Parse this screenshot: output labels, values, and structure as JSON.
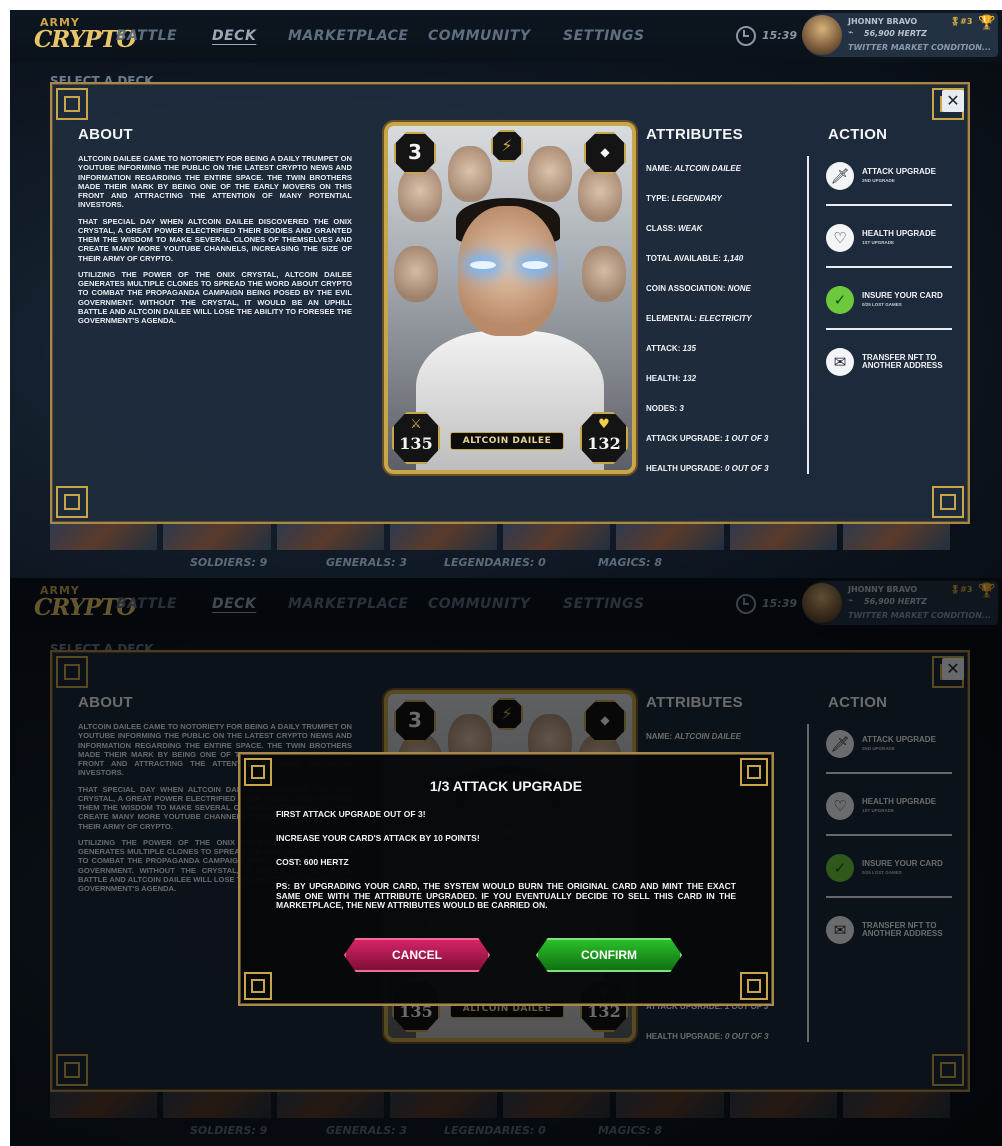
{
  "nav": {
    "logo_top": "ARMY",
    "logo_bottom": "CRYPTO",
    "items": [
      "BATTLE",
      "DECK",
      "MARKETPLACE",
      "COMMUNITY",
      "SETTINGS"
    ],
    "time": "15:39"
  },
  "user": {
    "name": "JHONNY BRAVO",
    "hertz": "56,900 HERTZ",
    "rank": "#3",
    "ticker": "TWITTER MARKET CONDITION..."
  },
  "deck": {
    "select_label": "SELECT A DECK",
    "counts": [
      "SOLDIERS: 9",
      "GENERALS: 3",
      "LEGENDARIES: 0",
      "MAGICS: 8"
    ]
  },
  "about": {
    "title": "ABOUT",
    "paragraphs": [
      "ALTCOIN DAILEE CAME TO NOTORIETY FOR BEING A DAILY TRUMPET ON YOUTUBE INFORMING THE PUBLIC ON THE LATEST CRYPTO NEWS AND INFORMATION REGARDING THE ENTIRE SPACE. THE TWIN BROTHERS MADE THEIR MARK BY BEING ONE OF THE EARLY MOVERS ON THIS FRONT AND ATTRACTING THE ATTENTION OF MANY POTENTIAL INVESTORS.",
      "THAT SPECIAL DAY WHEN ALTCOIN DAILEE DISCOVERED THE ONIX CRYSTAL, A GREAT POWER ELECTRIFIED THEIR BODIES AND GRANTED THEM THE WISDOM TO MAKE SEVERAL CLONES OF THEMSELVES AND CREATE MANY MORE YOUTUBE CHANNELS, INCREASING THE SIZE OF THEIR ARMY OF CRYPTO.",
      "UTILIZING THE POWER OF THE ONIX CRYSTAL, ALTCOIN DAILEE GENERATES MULTIPLE CLONES TO SPREAD THE WORD ABOUT CRYPTO TO COMBAT THE PROPAGANDA CAMPAIGN BEING POSED BY THE EVIL GOVERNMENT. WITHOUT THE CRYSTAL, IT WOULD BE AN UPHILL BATTLE AND ALTCOIN DAILEE WILL LOSE THE ABILITY TO FORESEE THE GOVERNMENT'S AGENDA."
    ]
  },
  "card": {
    "level": "3",
    "name": "ALTCOIN DAILEE",
    "attack": "135",
    "health": "132"
  },
  "attributes": {
    "title": "ATTRIBUTES",
    "rows": [
      {
        "label": "NAME: ",
        "value": "ALTCOIN DAILEE"
      },
      {
        "label": "TYPE: ",
        "value": "LEGENDARY"
      },
      {
        "label": "CLASS: ",
        "value": "WEAK"
      },
      {
        "label": "TOTAL AVAILABLE: ",
        "value": "1,140"
      },
      {
        "label": "COIN ASSOCIATION: ",
        "value": "NONE"
      },
      {
        "label": "ELEMENTAL: ",
        "value": "ELECTRICITY"
      },
      {
        "label": "ATTACK: ",
        "value": "135"
      },
      {
        "label": "HEALTH: ",
        "value": "132"
      },
      {
        "label": "NODES: ",
        "value": "3"
      },
      {
        "label": "ATTACK UPGRADE: ",
        "value": "1 OUT OF 3"
      },
      {
        "label": "HEALTH UPGRADE: ",
        "value": "0 OUT OF 3"
      }
    ]
  },
  "actions": {
    "title": "ACTION",
    "items": [
      {
        "label": "ATTACK UPGRADE",
        "sub": "2ND UPGRADE",
        "icon": "sword-icon"
      },
      {
        "label": "HEALTH UPGRADE",
        "sub": "1ST UPGRADE",
        "icon": "heart-plus-icon"
      },
      {
        "label": "INSURE YOUR CARD",
        "sub": "0/25 LOST GAMES",
        "icon": "shield-check-icon"
      },
      {
        "label": "TRANSFER NFT TO ANOTHER ADDRESS",
        "sub": "",
        "icon": "transfer-icon"
      }
    ]
  },
  "dialog": {
    "title": "1/3 ATTACK UPGRADE",
    "line1": "FIRST ATTACK UPGRADE OUT OF 3!",
    "line2": "INCREASE YOUR CARD'S ATTACK BY 10 POINTS!",
    "line3": "COST: 600 HERTZ",
    "line4": "PS: BY UPGRADING YOUR CARD, THE SYSTEM WOULD BURN THE ORIGINAL CARD AND MINT THE EXACT SAME ONE WITH THE ATTRIBUTE UPGRADED. IF YOU EVENTUALLY DECIDE TO SELL THIS CARD IN THE MARKETPLACE, THE NEW ATTRIBUTES WOULD BE CARRIED ON.",
    "cancel": "CANCEL",
    "confirm": "CONFIRM"
  },
  "colors": {
    "gold": "#c9a64a",
    "panel": "#1e2c3c",
    "confirm": "#2bc52b",
    "cancel": "#d9266a",
    "insure": "#6cc93d"
  }
}
